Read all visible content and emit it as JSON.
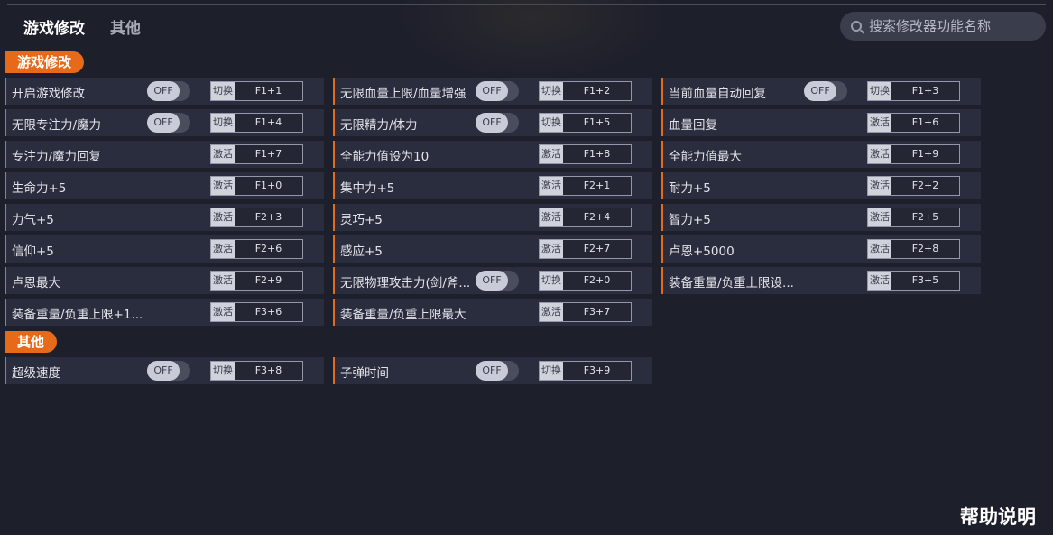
{
  "tabs": [
    "游戏修改",
    "其他"
  ],
  "search": {
    "placeholder": "搜索修改器功能名称"
  },
  "sections": [
    {
      "title": "游戏修改"
    },
    {
      "title": "其他"
    }
  ],
  "items": [
    {
      "label": "开启游戏修改",
      "toggle": "OFF",
      "action": "切换",
      "key": "F1+1"
    },
    {
      "label": "无限血量上限/血量增强",
      "toggle": "OFF",
      "action": "切换",
      "key": "F1+2"
    },
    {
      "label": "当前血量自动回复",
      "toggle": "OFF",
      "action": "切换",
      "key": "F1+3"
    },
    {
      "label": "无限专注力/魔力",
      "toggle": "OFF",
      "action": "切换",
      "key": "F1+4"
    },
    {
      "label": "无限精力/体力",
      "toggle": "OFF",
      "action": "切换",
      "key": "F1+5"
    },
    {
      "label": "血量回复",
      "action": "激活",
      "key": "F1+6"
    },
    {
      "label": "专注力/魔力回复",
      "action": "激活",
      "key": "F1+7"
    },
    {
      "label": "全能力值设为10",
      "action": "激活",
      "key": "F1+8"
    },
    {
      "label": "全能力值最大",
      "action": "激活",
      "key": "F1+9"
    },
    {
      "label": "生命力+5",
      "action": "激活",
      "key": "F1+0"
    },
    {
      "label": "集中力+5",
      "action": "激活",
      "key": "F2+1"
    },
    {
      "label": "耐力+5",
      "action": "激活",
      "key": "F2+2"
    },
    {
      "label": "力气+5",
      "action": "激活",
      "key": "F2+3"
    },
    {
      "label": "灵巧+5",
      "action": "激活",
      "key": "F2+4"
    },
    {
      "label": "智力+5",
      "action": "激活",
      "key": "F2+5"
    },
    {
      "label": "信仰+5",
      "action": "激活",
      "key": "F2+6"
    },
    {
      "label": "感应+5",
      "action": "激活",
      "key": "F2+7"
    },
    {
      "label": "卢恩+5000",
      "action": "激活",
      "key": "F2+8"
    },
    {
      "label": "卢恩最大",
      "action": "激活",
      "key": "F2+9"
    },
    {
      "label": "无限物理攻击力(剑/斧...",
      "toggle": "OFF",
      "action": "切换",
      "key": "F2+0"
    },
    {
      "label": "装备重量/负重上限设...",
      "action": "激活",
      "key": "F3+5"
    },
    {
      "label": "装备重量/负重上限+1...",
      "action": "激活",
      "key": "F3+6"
    },
    {
      "label": "装备重量/负重上限最大",
      "action": "激活",
      "key": "F3+7"
    },
    {
      "label": "超级速度",
      "toggle": "OFF",
      "action": "切换",
      "key": "F3+8"
    },
    {
      "label": "子弹时间",
      "toggle": "OFF",
      "action": "切换",
      "key": "F3+9"
    }
  ],
  "help_label": "帮助说明",
  "colors": {
    "accent": "#e76a1b",
    "background": "#1d1f2b",
    "row": "#2a2d3d"
  }
}
